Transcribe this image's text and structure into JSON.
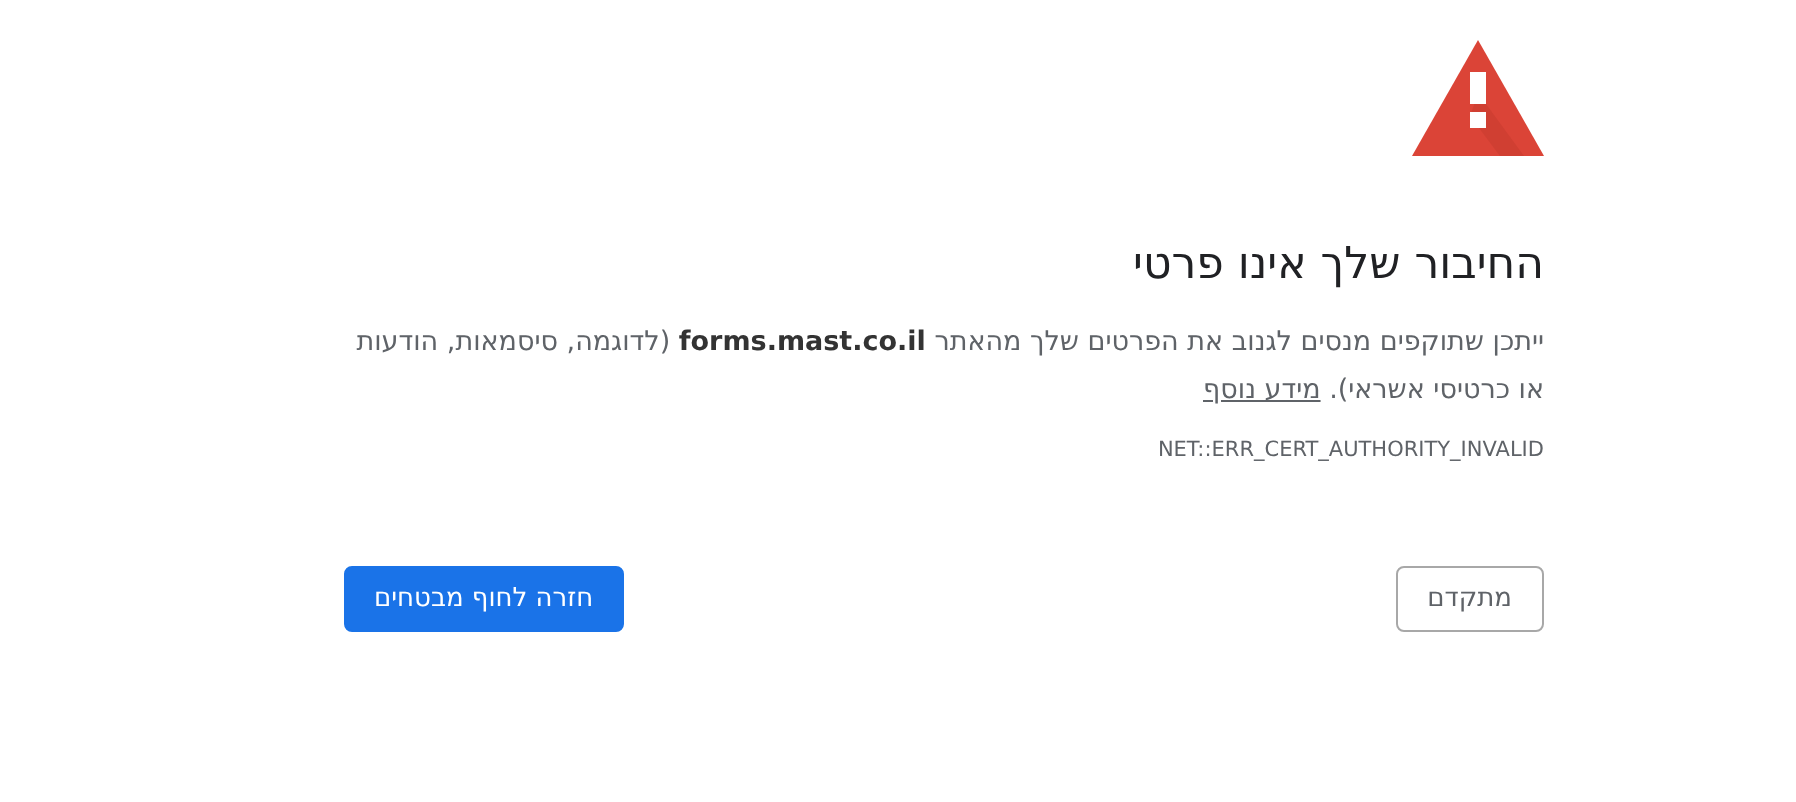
{
  "title": "החיבור שלך אינו פרטי",
  "description": {
    "text": "ייתכן שתוקפים מנסים לגנוב את הפרטים שלך מהאתר **forms.mast.co.il** (לדוגמה, סיסמאות, הודעות או כרטיסי אשראי).",
    "link": "מידע נוסף"
  },
  "error_code": "NET::ERR_CERT_AUTHORITY_INVALID",
  "buttons": [
    {
      "label": "מתקדם",
      "kind": "secondary"
    },
    {
      "label": "חזרה לחוף מבטחים",
      "kind": "primary"
    }
  ]
}
